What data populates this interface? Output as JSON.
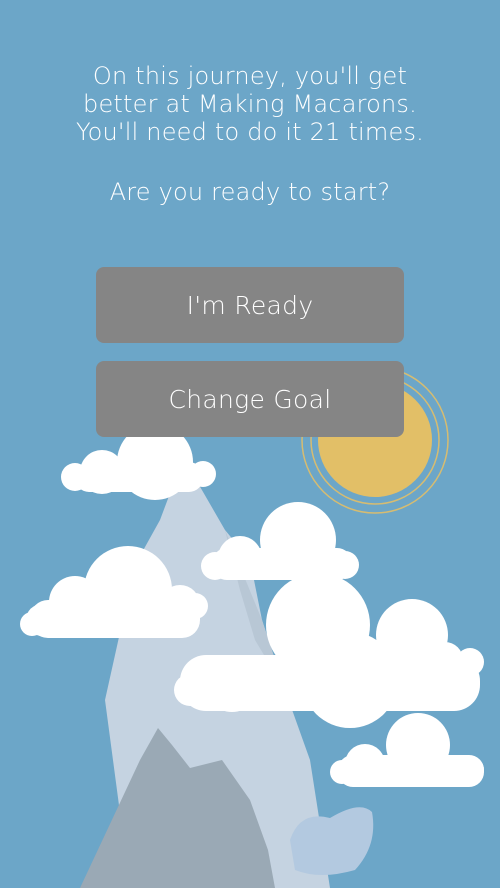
{
  "intro": {
    "line1": "On this journey, you'll get",
    "line2": "better at Making Macarons.",
    "line3": "You'll need to do it 21 times.",
    "question": "Are you ready to start?"
  },
  "buttons": {
    "ready_label": "I'm Ready",
    "change_goal_label": "Change Goal"
  },
  "colors": {
    "background": "#6ca6c8",
    "button": "#858585",
    "sun": "#e2bf67",
    "mountain_light": "#c5d3e1",
    "mountain_dark": "#9aa9b5",
    "cloud": "#ffffff"
  }
}
